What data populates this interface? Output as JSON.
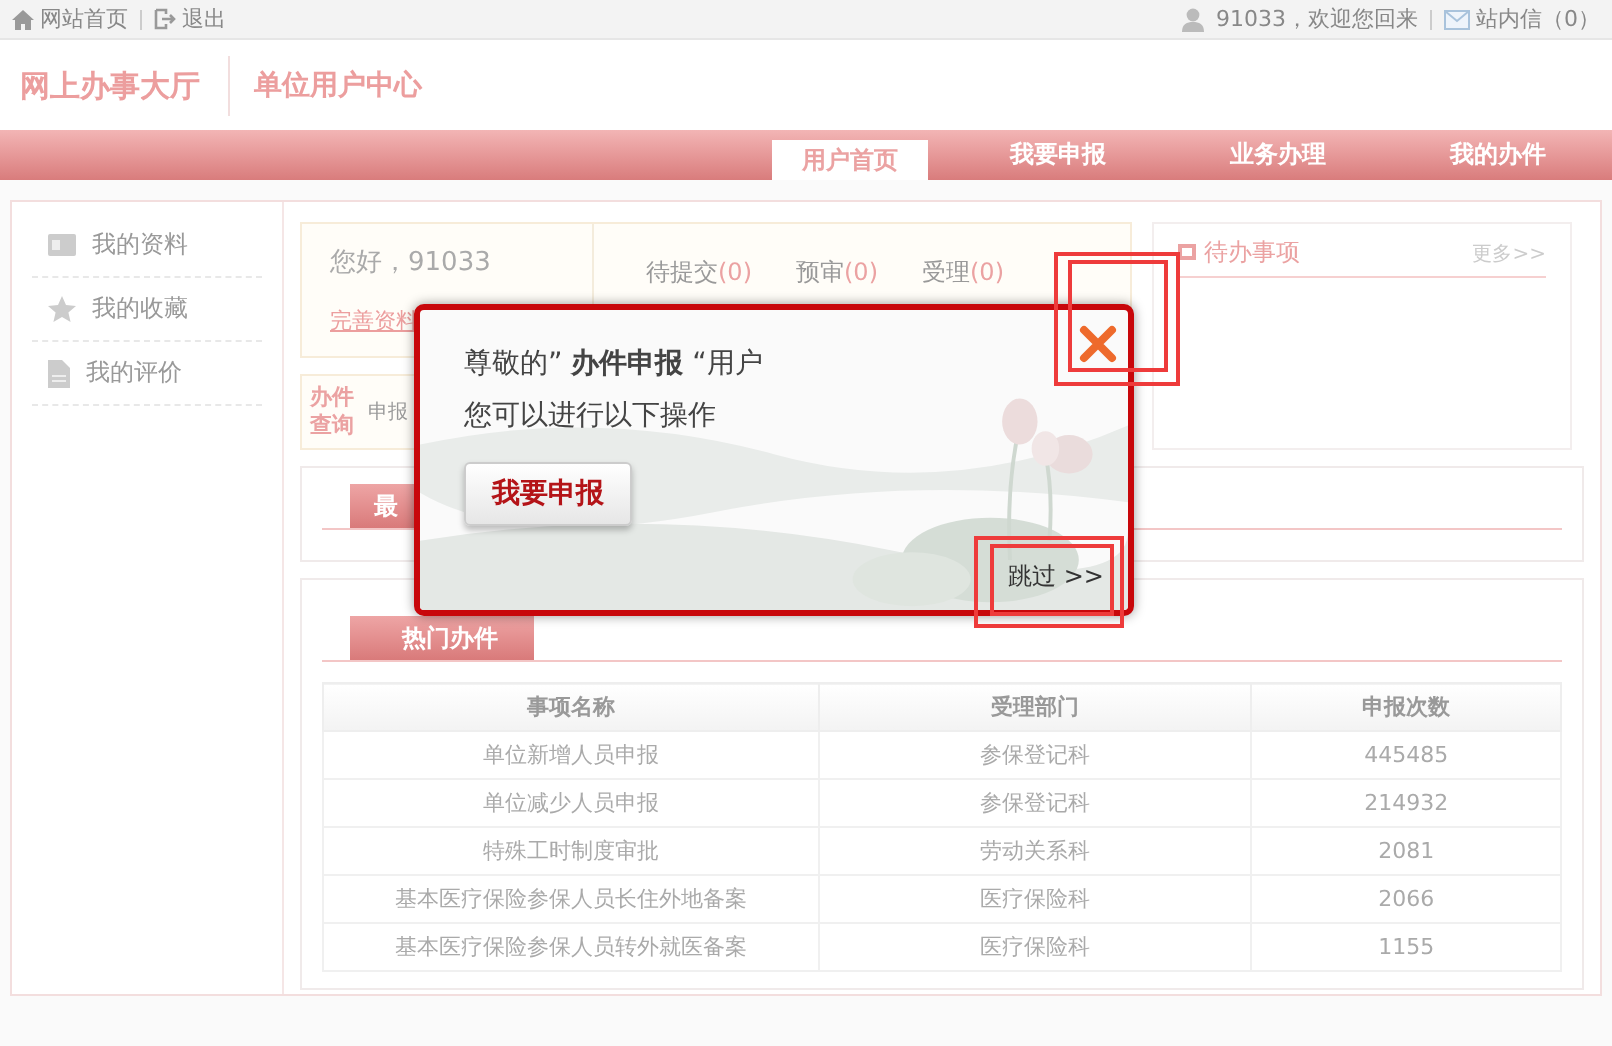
{
  "top_bar": {
    "links": [
      {
        "kind": "home",
        "label": "网站首页"
      },
      {
        "kind": "logout",
        "label": "退出"
      }
    ],
    "greeting": "91033，欢迎您回来",
    "messages": "站内信（0）"
  },
  "header": {
    "logo": "网上办事大厅",
    "subtitle": "单位用户中心"
  },
  "nav": [
    {
      "label": "用户首页",
      "selected": true
    },
    {
      "label": "我要申报",
      "selected": false
    },
    {
      "label": "业务办理",
      "selected": false
    },
    {
      "label": "我的办件",
      "selected": false
    }
  ],
  "sidebar": [
    {
      "kind": "profile",
      "label": "我的资料"
    },
    {
      "kind": "favorites",
      "label": "我的收藏"
    },
    {
      "kind": "reviews",
      "label": "我的评价"
    }
  ],
  "welcome": {
    "greeting": "您好，91033",
    "link": "完善资料",
    "counts": [
      {
        "label": "待提交",
        "count": "(0)"
      },
      {
        "label": "预审",
        "count": "(0)"
      },
      {
        "label": "受理",
        "count": "(0)"
      }
    ]
  },
  "query": {
    "title": "办件查询",
    "text": "申报"
  },
  "todo": {
    "title": "待办事项",
    "more": "更多>>"
  },
  "recent": {
    "tab": "最"
  },
  "hot": {
    "tab": "热门办件",
    "table": {
      "columns": [
        "事项名称",
        "受理部门",
        "申报次数"
      ],
      "rows": [
        [
          "单位新增人员申报",
          "参保登记科",
          "445485"
        ],
        [
          "单位减少人员申报",
          "参保登记科",
          "214932"
        ],
        [
          "特殊工时制度审批",
          "劳动关系科",
          "2081"
        ],
        [
          "基本医疗保险参保人员长住外地备案",
          "医疗保险科",
          "2066"
        ],
        [
          "基本医疗保险参保人员转外就医备案",
          "医疗保险科",
          "1155"
        ]
      ]
    }
  },
  "dialog": {
    "greeting": "尊敬的” **办件申报** “用户",
    "prompt": "您可以进行以下操作",
    "button": "我要申报",
    "skip": "跳过 >>",
    "close_highlighted": true,
    "skip_highlighted": true
  }
}
